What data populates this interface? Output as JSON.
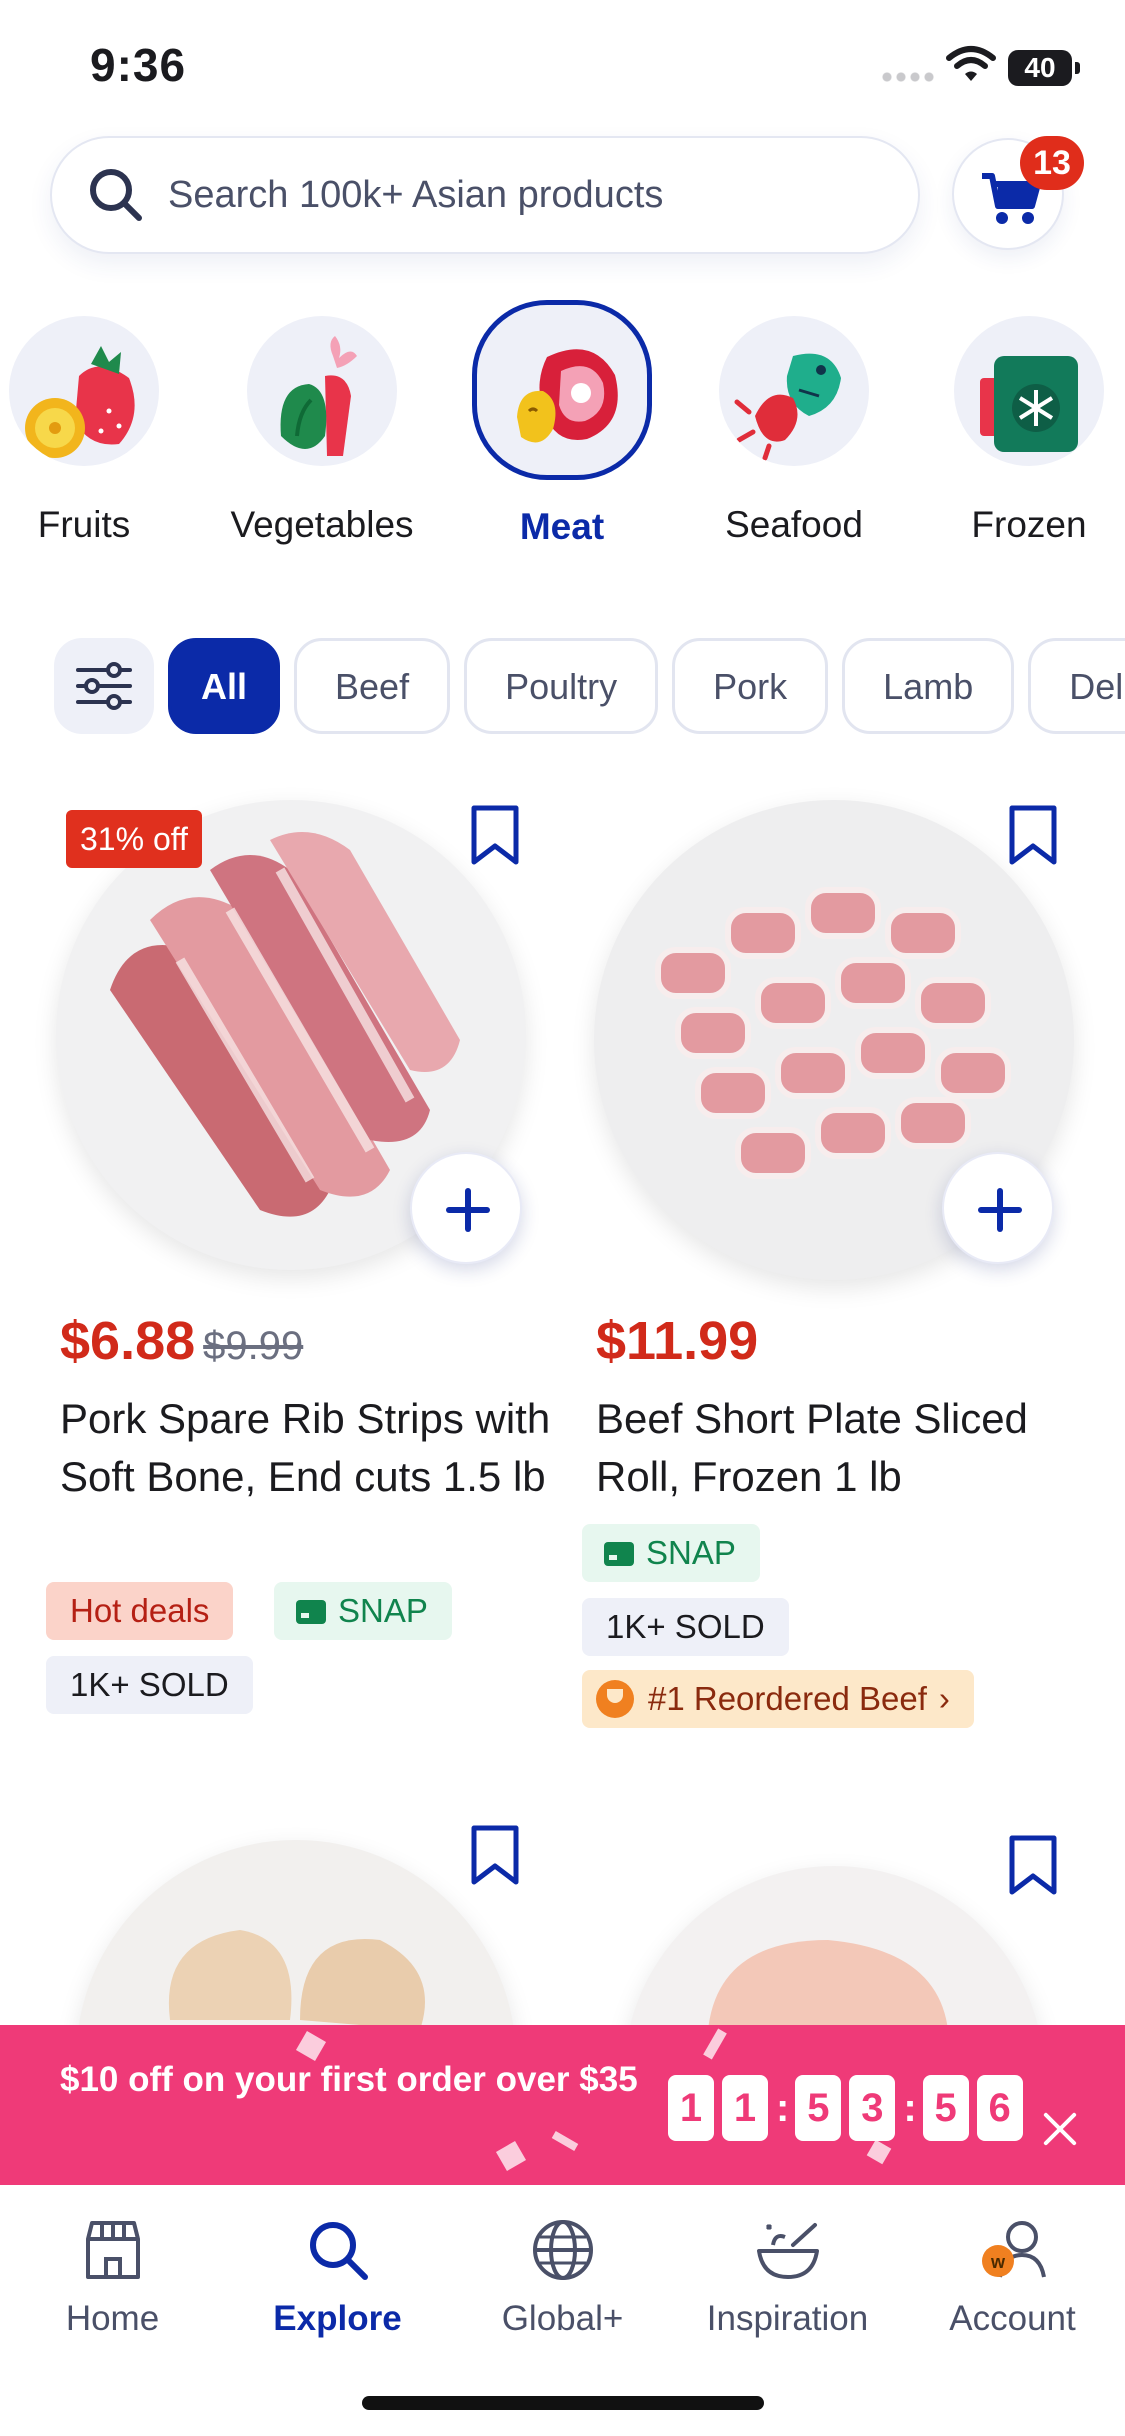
{
  "status_bar": {
    "time": "9:36",
    "battery": "40"
  },
  "search": {
    "placeholder": "Search 100k+ Asian products"
  },
  "cart": {
    "badge_count": "13"
  },
  "categories": [
    {
      "label": "Fruits",
      "icon": "fruits-icon"
    },
    {
      "label": "Vegetables",
      "icon": "vegetables-icon"
    },
    {
      "label": "Meat",
      "icon": "meat-icon",
      "selected": true
    },
    {
      "label": "Seafood",
      "icon": "seafood-icon"
    },
    {
      "label": "Frozen",
      "icon": "frozen-icon"
    }
  ],
  "filters": {
    "chips": [
      "All",
      "Beef",
      "Poultry",
      "Pork",
      "Lamb",
      "Deli"
    ],
    "active": "All"
  },
  "products": [
    {
      "discount": "31% off",
      "price": "$6.88",
      "original_price": "$9.99",
      "name": "Pork Spare Rib Strips with Soft Bone, End cuts 1.5 lb",
      "tags": {
        "hot": "Hot deals",
        "snap": "SNAP",
        "sold": "1K+ SOLD"
      }
    },
    {
      "price": "$11.99",
      "name": "Beef Short Plate Sliced Roll, Frozen 1 lb",
      "tags": {
        "snap": "SNAP",
        "sold": "1K+ SOLD",
        "rank": "#1 Reordered Beef"
      }
    }
  ],
  "promo": {
    "text": "$10 off on your first order over $35",
    "timer": [
      "1",
      "1",
      "5",
      "3",
      "5",
      "6"
    ]
  },
  "nav": [
    {
      "label": "Home",
      "icon": "store-icon"
    },
    {
      "label": "Explore",
      "icon": "search-icon",
      "active": true
    },
    {
      "label": "Global+",
      "icon": "globe-icon"
    },
    {
      "label": "Inspiration",
      "icon": "bowl-icon"
    },
    {
      "label": "Account",
      "icon": "account-icon"
    }
  ],
  "colors": {
    "brand": "#0b2aa8",
    "price": "#d12a1a",
    "promo": "#ef3a78",
    "badge": "#e02d1b"
  }
}
